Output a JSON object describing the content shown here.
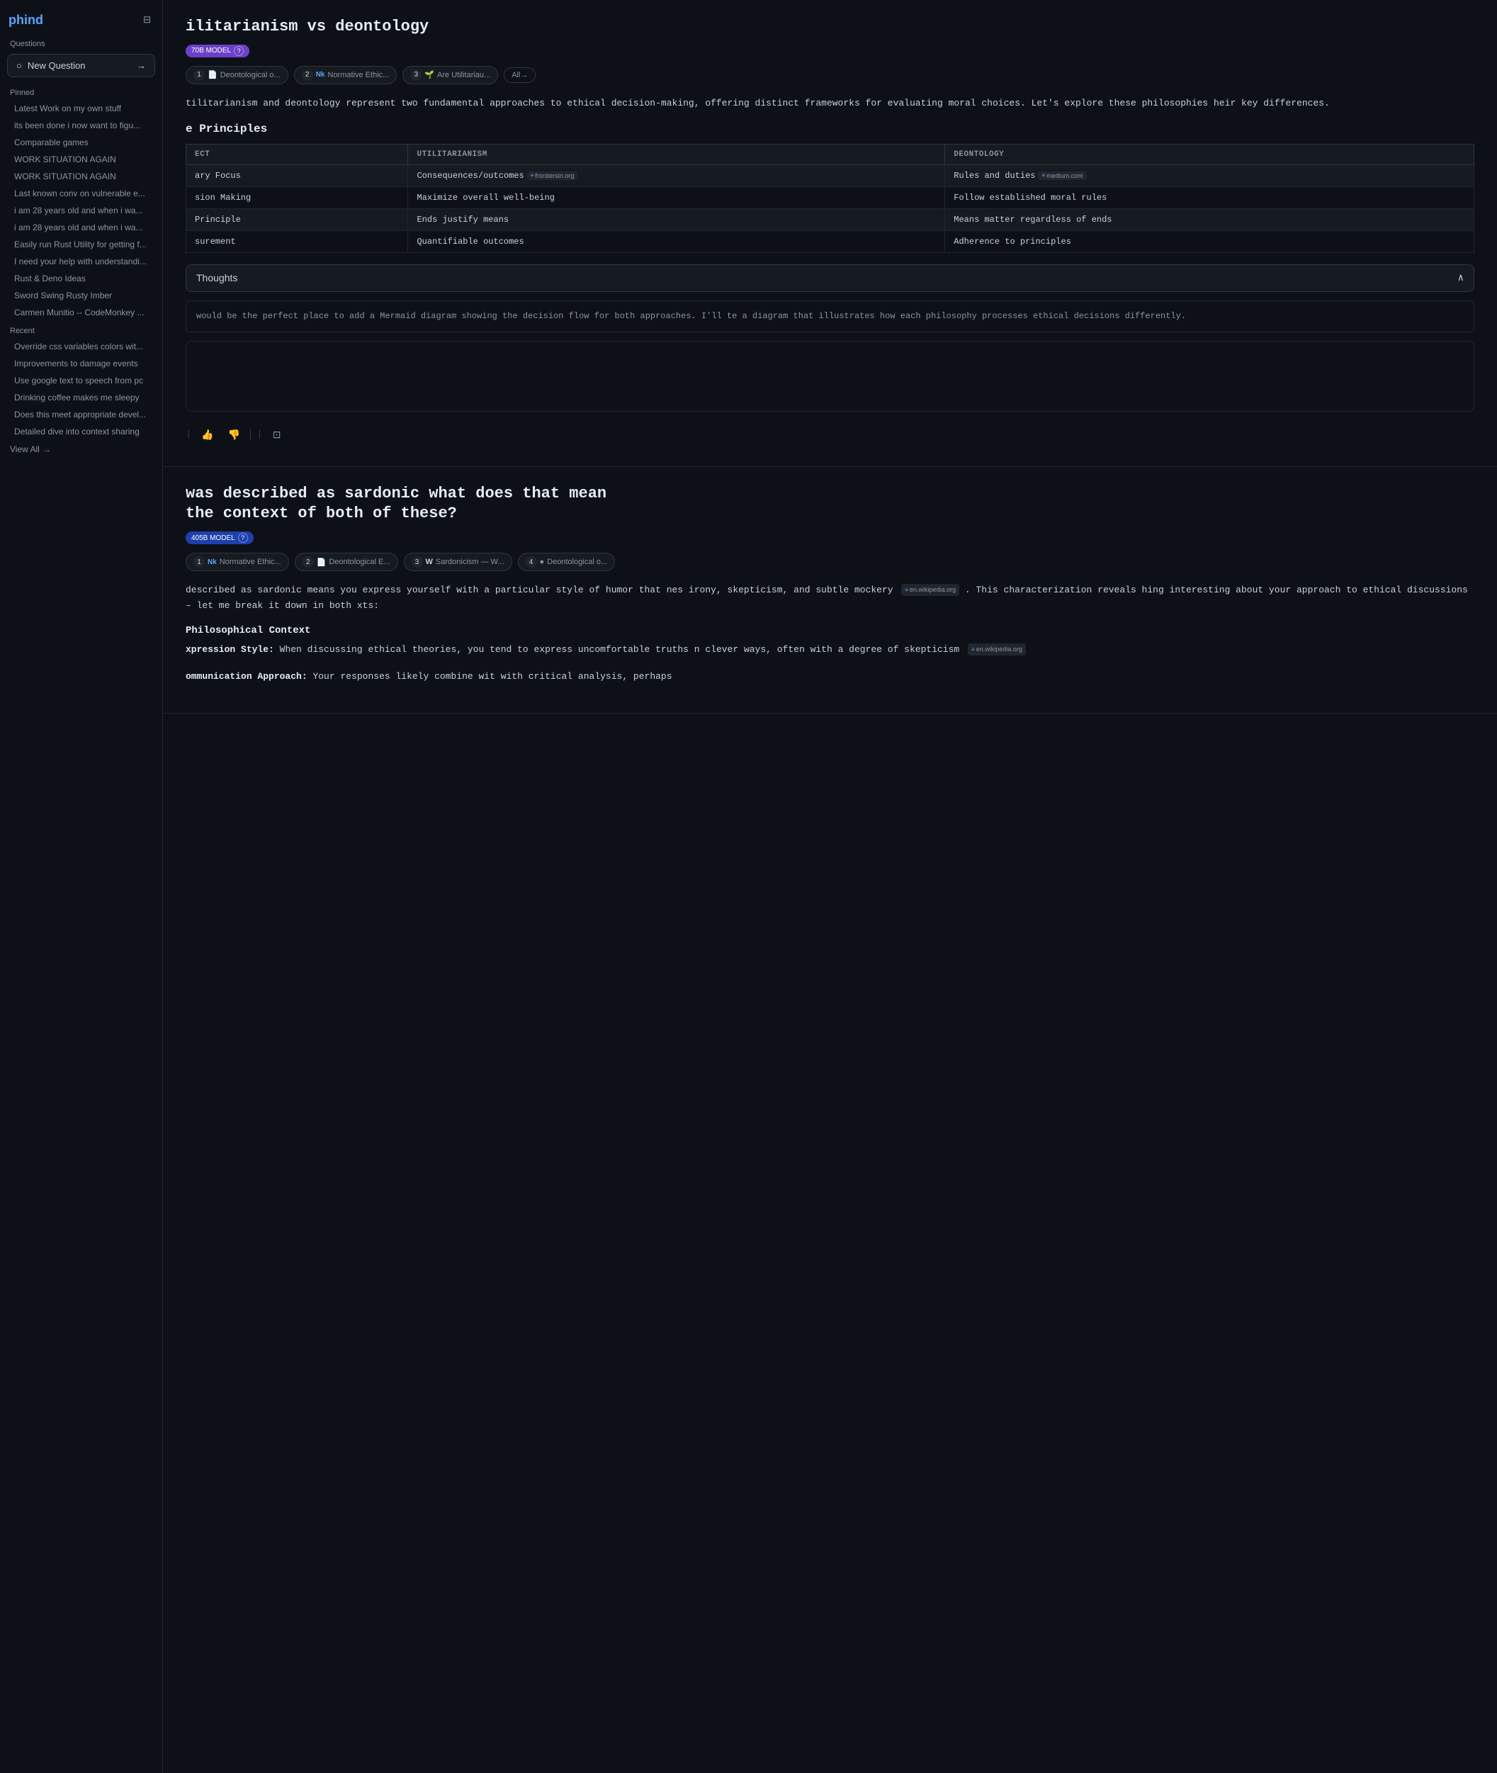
{
  "sidebar": {
    "logo": "phind",
    "questions_label": "Questions",
    "new_question_label": "New Question",
    "pinned_label": "Pinned",
    "recent_label": "Recent",
    "view_all_label": "View All",
    "pinned_items": [
      "Latest Work on my own stuff",
      "its been done i now want to figu...",
      "Comparable games",
      "WORK SITUATION AGAIN",
      "WORK SITUATION AGAIN",
      "Last known conv on vulnerable e...",
      "i am 28 years old and when i wa...",
      "i am 28 years old and when i wa...",
      "Easily run Rust Utility for getting f...",
      "I need your help with understandi...",
      "Rust & Deno Ideas",
      "Sword Swing Rusty Imber",
      "Carmen Munitio -- CodeMonkey ..."
    ],
    "recent_items": [
      "Override css variables colors wit...",
      "Improvements to damage events",
      "Use google text to speech from pc",
      "Drinking coffee makes me sleepy",
      "Does this meet appropriate devel...",
      "Detailed dive into context sharing"
    ]
  },
  "question1": {
    "title": "ilitarianism vs deontology",
    "model_badge": "70B MODEL",
    "sources": [
      {
        "num": "1",
        "icon": "📄",
        "label": "Deontological o..."
      },
      {
        "num": "2",
        "icon": "Nk",
        "label": "Normative Ethic..."
      },
      {
        "num": "3",
        "icon": "🌱",
        "label": "Are Utilitariau..."
      }
    ],
    "all_label": "All→",
    "intro_text": "tilitarianism and deontology represent two fundamental approaches to ethical decision-making, offering distinct frameworks for evaluating moral choices. Let's explore these philosophies heir key differences.",
    "table_heading": "e Principles",
    "table_headers": [
      "ECT",
      "UTILITARIANISM",
      "DEONTOLOGY"
    ],
    "table_rows": [
      {
        "aspect": "ary Focus",
        "util": "Consequences/outcomes",
        "util_source": "frontiersin.org",
        "deon": "Rules and duties",
        "deon_source": "medium.com"
      },
      {
        "aspect": "sion Making",
        "util": "Maximize overall well-being",
        "util_source": "",
        "deon": "Follow established moral rules",
        "deon_source": ""
      },
      {
        "aspect": "Principle",
        "util": "Ends justify means",
        "util_source": "",
        "deon": "Means matter regardless of ends",
        "deon_source": ""
      },
      {
        "aspect": "surement",
        "util": "Quantifiable outcomes",
        "util_source": "",
        "deon": "Adherence to principles",
        "deon_source": ""
      }
    ],
    "thoughts_label": "Thoughts",
    "thoughts_text": "would be the perfect place to add a Mermaid diagram showing the decision flow for both approaches. I'll te a diagram that illustrates how each philosophy processes ethical decisions differently."
  },
  "question2": {
    "title_line1": "was described as sardonic what does that mean",
    "title_line2": "the context of both of these?",
    "model_badge": "405B MODEL",
    "sources": [
      {
        "num": "1",
        "icon": "Nk",
        "label": "Normative Ethic..."
      },
      {
        "num": "2",
        "icon": "📄",
        "label": "Deontological E..."
      },
      {
        "num": "3",
        "icon": "W",
        "label": "Sardonicism — W..."
      },
      {
        "num": "4",
        "icon": "●",
        "label": "Deontological o..."
      }
    ],
    "intro_text": "described as sardonic means you express yourself with a particular style of humor that nes irony, skepticism, and subtle mockery",
    "inline_source": "en.wikipedia.org",
    "intro_text2": ". This characterization reveals hing interesting about your approach to ethical discussions – let me break it down in both xts:",
    "philosophical_context_heading": "Philosophical Context",
    "expression_style_label": "xpression Style:",
    "expression_style_text": "When discussing ethical theories, you tend to express uncomfortable truths n clever ways, often with a degree of skepticism",
    "expression_source": "en.wikipedia.org",
    "communication_label": "ommunication Approach:",
    "communication_text": "Your responses likely combine wit with critical analysis, perhaps"
  },
  "icons": {
    "sidebar_toggle": "⊟",
    "search": "○",
    "arrow_right": "→",
    "chevron_up": "∧",
    "thumb_up": "👍",
    "thumb_down": "👎",
    "copy": "⊡",
    "info": "?"
  }
}
